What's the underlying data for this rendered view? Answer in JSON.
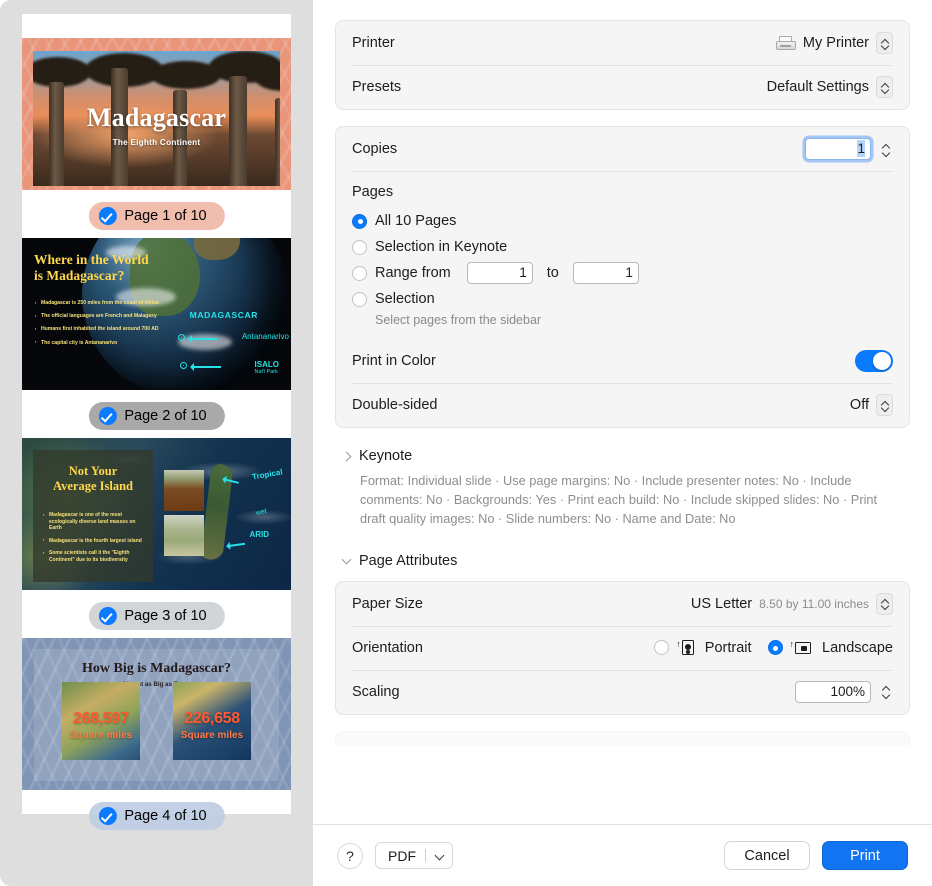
{
  "sidebar": {
    "slides": [
      {
        "badge": "Page 1 of 10",
        "title": "Madagascar",
        "subtitle": "The Eighth Continent",
        "badge_bg": "rgba(233,149,122,0.55)"
      },
      {
        "badge": "Page 2 of 10",
        "title_line1": "Where in the World",
        "title_line2": "is Madagascar?",
        "bullets": [
          "Madagascar is 250 miles from the coast of Africa",
          "The official languages are French and Malagasy",
          "Humans first inhabited the island around 700 AD",
          "The capital city is Antananarivo"
        ],
        "label_country": "MADAGASCAR",
        "label_capital": "Antananarivo",
        "label_park": "ISALO",
        "label_park_sub": "Nat'l Park",
        "badge_bg": "rgba(150,150,150,0.80)"
      },
      {
        "badge": "Page 3 of 10",
        "title_line1": "Not Your",
        "title_line2": "Average Island",
        "bullets": [
          "Madagascar is one of the most ecologically diverse land masses on Earth",
          "Madagascar is the fourth largest island",
          "Some scientists call it the \"Eighth Continent\" due to its biodiversity"
        ],
        "label_tropical": "Tropical",
        "label_mid": "wet",
        "label_arid": "ARID",
        "badge_bg": "rgba(205,208,212,0.88)"
      },
      {
        "badge": "Page 4 of 10",
        "title": "How Big is Madagascar?",
        "subtitle": "Almost as Big as Texas",
        "stat_left_number": "268,597",
        "stat_left_unit": "Square miles",
        "stat_right_number": "226,658",
        "stat_right_unit": "Square miles",
        "badge_bg": "rgba(190,205,228,0.90)"
      }
    ]
  },
  "printer_group": {
    "printer_label": "Printer",
    "printer_value": "My Printer",
    "presets_label": "Presets",
    "presets_value": "Default Settings"
  },
  "copies_group": {
    "copies_label": "Copies",
    "copies_value": "1",
    "pages_title": "Pages",
    "options": [
      {
        "label": "All 10 Pages",
        "selected": true
      },
      {
        "label": "Selection in Keynote",
        "selected": false
      },
      {
        "label": "Range from",
        "selected": false
      },
      {
        "label": "Selection",
        "selected": false
      }
    ],
    "range_from_value": "1",
    "range_to_word": "to",
    "range_to_value": "1",
    "selection_hint": "Select pages from the sidebar",
    "print_in_color_label": "Print in Color",
    "print_in_color_state": "on",
    "double_sided_label": "Double-sided",
    "double_sided_value": "Off"
  },
  "keynote_section": {
    "title": "Keynote",
    "expanded": false,
    "summary": "Format: Individual slide · Use page margins: No · Include presenter notes: No · Include comments: No · Backgrounds: Yes · Print each build: No · Include skipped slides: No · Print draft quality images: No · Slide numbers: No · Name and Date: No"
  },
  "page_attributes": {
    "title": "Page Attributes",
    "expanded": true,
    "paper_size_label": "Paper Size",
    "paper_size_value": "US Letter",
    "paper_size_dimensions": "8.50 by 11.00 inches",
    "orientation_label": "Orientation",
    "orientation_portrait": "Portrait",
    "orientation_landscape": "Landscape",
    "orientation_selected": "Landscape",
    "scaling_label": "Scaling",
    "scaling_value": "100%"
  },
  "footer": {
    "help_label": "?",
    "pdf_label": "PDF",
    "cancel_label": "Cancel",
    "print_label": "Print"
  },
  "colors": {
    "accent_blue": "#0a7bfd",
    "print_button_blue": "#1274f0",
    "sidebar_gray": "#dedede",
    "group_bg": "#f5f5f5"
  }
}
